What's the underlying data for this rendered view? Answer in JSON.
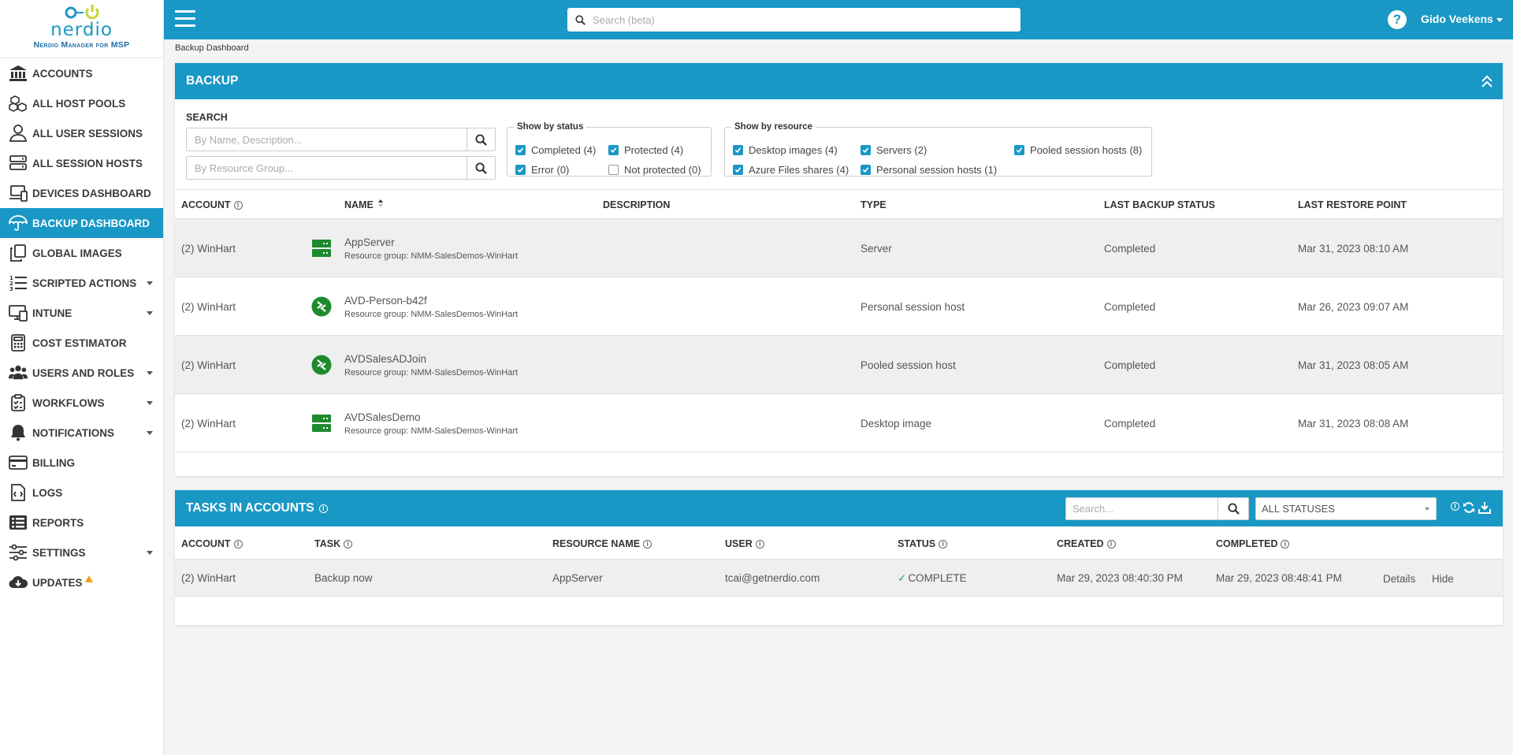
{
  "app": {
    "brand": "nerdio",
    "subtitle": "Nerdio Manager for MSP",
    "search_placeholder": "Search (beta)",
    "user_name": "Gido Veekens",
    "help_label": "?",
    "accent_color": "#1a98c5"
  },
  "sidebar": {
    "items": [
      {
        "label": "Accounts",
        "icon": "bank-icon"
      },
      {
        "label": "All Host Pools",
        "icon": "cubes-icon"
      },
      {
        "label": "All User Sessions",
        "icon": "user-icon"
      },
      {
        "label": "All Session Hosts",
        "icon": "server-icon"
      },
      {
        "label": "Devices Dashboard",
        "icon": "devices-icon"
      },
      {
        "label": "Backup Dashboard",
        "icon": "umbrella-icon",
        "active": true
      },
      {
        "label": "Global Images",
        "icon": "copy-icon"
      },
      {
        "label": "Scripted Actions",
        "icon": "list-ordered-icon",
        "expandable": true
      },
      {
        "label": "Intune",
        "icon": "desktop-icon",
        "expandable": true
      },
      {
        "label": "Cost Estimator",
        "icon": "calculator-icon"
      },
      {
        "label": "Users and Roles",
        "icon": "users-icon",
        "expandable": true
      },
      {
        "label": "Workflows",
        "icon": "clipboard-icon",
        "expandable": true
      },
      {
        "label": "Notifications",
        "icon": "bell-icon",
        "expandable": true
      },
      {
        "label": "Billing",
        "icon": "credit-card-icon"
      },
      {
        "label": "Logs",
        "icon": "file-code-icon"
      },
      {
        "label": "Reports",
        "icon": "list-icon"
      },
      {
        "label": "Settings",
        "icon": "sliders-icon",
        "expandable": true
      },
      {
        "label": "Updates",
        "icon": "cloud-download-icon",
        "badge": "warning"
      }
    ]
  },
  "breadcrumb": "Backup Dashboard",
  "backup": {
    "title": "BACKUP",
    "search_label": "SEARCH",
    "search_name_placeholder": "By Name, Description...",
    "search_rg_placeholder": "By Resource Group...",
    "status_legend": "Show by status",
    "status_filters": [
      {
        "label": "Completed (4)",
        "checked": true
      },
      {
        "label": "Protected (4)",
        "checked": true
      },
      {
        "label": "Error (0)",
        "checked": true
      },
      {
        "label": "Not protected (0)",
        "checked": false
      }
    ],
    "resource_legend": "Show by resource",
    "resource_filters": [
      {
        "label": "Desktop images (4)",
        "checked": true
      },
      {
        "label": "Servers (2)",
        "checked": true
      },
      {
        "label": "Pooled session hosts (8)",
        "checked": true
      },
      {
        "label": "Azure Files shares (4)",
        "checked": true
      },
      {
        "label": "Personal session hosts (1)",
        "checked": true
      }
    ],
    "columns": [
      "ACCOUNT",
      "NAME",
      "DESCRIPTION",
      "TYPE",
      "LAST BACKUP STATUS",
      "LAST RESTORE POINT"
    ],
    "rows": [
      {
        "account": "(2) WinHart",
        "name": "AppServer",
        "resource_group": "Resource group: NMM-SalesDemos-WinHart",
        "description": "",
        "type": "Server",
        "status": "Completed",
        "restore_point": "Mar 31, 2023 08:10 AM",
        "icon": "server-green-icon"
      },
      {
        "account": "(2) WinHart",
        "name": "AVD-Person-b42f",
        "resource_group": "Resource group: NMM-SalesDemos-WinHart",
        "description": "",
        "type": "Personal session host",
        "status": "Completed",
        "restore_point": "Mar 26, 2023 09:07 AM",
        "icon": "remote-desktop-icon"
      },
      {
        "account": "(2) WinHart",
        "name": "AVDSalesADJoin",
        "resource_group": "Resource group: NMM-SalesDemos-WinHart",
        "description": "",
        "type": "Pooled session host",
        "status": "Completed",
        "restore_point": "Mar 31, 2023 08:05 AM",
        "icon": "remote-desktop-icon"
      },
      {
        "account": "(2) WinHart",
        "name": "AVDSalesDemo",
        "resource_group": "Resource group: NMM-SalesDemos-WinHart",
        "description": "",
        "type": "Desktop image",
        "status": "Completed",
        "restore_point": "Mar 31, 2023 08:08 AM",
        "icon": "server-green-icon"
      }
    ]
  },
  "tasks": {
    "title": "TASKS IN ACCOUNTS",
    "search_placeholder": "Search...",
    "status_select": "ALL STATUSES",
    "columns": [
      "ACCOUNT",
      "TASK",
      "RESOURCE NAME",
      "USER",
      "STATUS",
      "CREATED",
      "COMPLETED"
    ],
    "rows": [
      {
        "account": "(2) WinHart",
        "task": "Backup now",
        "resource": "AppServer",
        "user": "tcai@getnerdio.com",
        "status": "COMPLETE",
        "created": "Mar 29, 2023 08:40:30 PM",
        "completed": "Mar 29, 2023 08:48:41 PM",
        "details_label": "Details",
        "hide_label": "Hide"
      }
    ]
  }
}
